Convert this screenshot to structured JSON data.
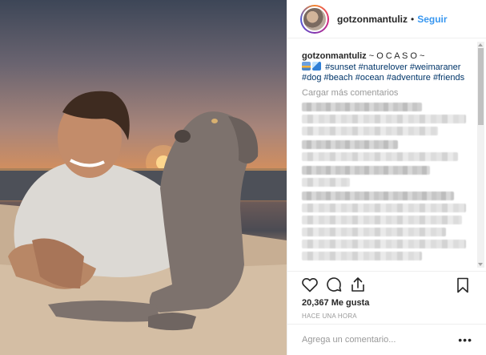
{
  "post": {
    "username": "gotzonmantuliz",
    "separator": "•",
    "follow_label": "Seguir"
  },
  "caption": {
    "username": "gotzonmantuliz",
    "text": "~ O C A S O ~",
    "hashtags": [
      "#sunset",
      "#naturelover",
      "#weimaraner",
      "#dog",
      "#beach",
      "#ocean",
      "#adventure",
      "#friends"
    ]
  },
  "load_more_label": "Cargar más comentarios",
  "likes": "20,367 Me gusta",
  "timestamp": "HACE UNA HORA",
  "comment_input": {
    "placeholder": "Agrega un comentario..."
  },
  "more_options_label": "•••",
  "icons": {
    "like": "heart-icon",
    "comment": "comment-icon",
    "share": "share-icon",
    "save": "bookmark-icon",
    "more": "more-options-icon"
  },
  "colors": {
    "link_blue": "#3897f0",
    "hashtag": "#003569",
    "muted": "#999999",
    "text": "#262626"
  }
}
